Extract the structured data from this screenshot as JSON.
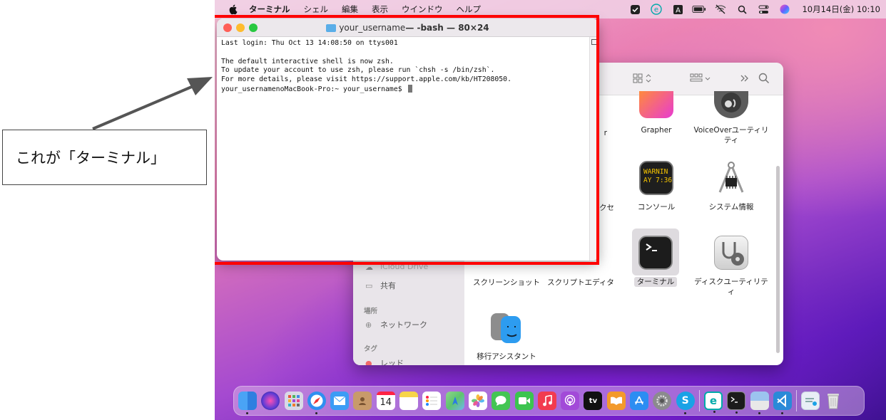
{
  "annotation": {
    "text": "これが「ターミナル」"
  },
  "menubar": {
    "app_name": "ターミナル",
    "items": [
      "シェル",
      "編集",
      "表示",
      "ウインドウ",
      "ヘルプ"
    ],
    "clock": "10月14日(金)  10:10",
    "status_icons": [
      "shield-check-icon",
      "eset-icon",
      "input-method-icon",
      "battery-icon",
      "wifi-off-icon",
      "search-icon",
      "control-center-icon",
      "siri-icon"
    ]
  },
  "terminal": {
    "title": "your_username — -bash — 80×24",
    "title_user": "your_username",
    "title_rest": " — -bash — 80×24",
    "lines": [
      "Last login: Thu Oct 13 14:08:50 on ttys001",
      "",
      "The default interactive shell is now zsh.",
      "To update your account to use zsh, please run `chsh -s /bin/zsh`.",
      "For more details, please visit https://support.apple.com/kb/HT208050."
    ],
    "prompt": "your_usernamenoMacBook-Pro:~ your_username$ "
  },
  "finder": {
    "sidebar": {
      "icloud": "iCloud Drive",
      "shared": "共有",
      "locations_header": "場所",
      "network": "ネットワーク",
      "tags_header": "タグ",
      "tag_red": "レッド"
    },
    "apps": [
      {
        "name": "Grapher",
        "icon": "grapher-icon"
      },
      {
        "name": "VoiceOverユーティリティ",
        "icon": "voiceover-icon"
      },
      {
        "name": "コンソール",
        "icon": "console-icon",
        "text": "WARNIN\nAY 7:36"
      },
      {
        "name": "システム情報",
        "icon": "system-info-icon"
      },
      {
        "name": "ターミナル",
        "icon": "terminal-icon",
        "selected": true
      },
      {
        "name": "ディスクユーティリティ",
        "icon": "disk-utility-icon"
      },
      {
        "name": "スクリーンショット",
        "icon": "screenshot-icon"
      },
      {
        "name": "スクリプトエディタ",
        "icon": "script-editor-icon"
      },
      {
        "name": "移行アシスタント",
        "icon": "migration-assistant-icon"
      }
    ],
    "partial_labels": {
      "left_top": "r",
      "left_mid": "クセ"
    }
  },
  "dock": {
    "items": [
      {
        "name": "finder-icon",
        "color": "#3d8ef0",
        "running": true
      },
      {
        "name": "siri-icon",
        "color": "#2a2a6a"
      },
      {
        "name": "launchpad-icon",
        "color": "#d9d9e6"
      },
      {
        "name": "safari-icon",
        "color": "#2f8ff0",
        "running": true
      },
      {
        "name": "mail-icon",
        "color": "#3c9cf5"
      },
      {
        "name": "contacts-icon",
        "color": "#c89a6a"
      },
      {
        "name": "calendar-icon",
        "color": "#ffffff",
        "label": "14"
      },
      {
        "name": "notes-icon",
        "color": "#f7d54a"
      },
      {
        "name": "reminders-icon",
        "color": "#ffffff"
      },
      {
        "name": "maps-icon",
        "color": "#5ec46e"
      },
      {
        "name": "photos-icon",
        "color": "#ffffff"
      },
      {
        "name": "messages-icon",
        "color": "#43c553"
      },
      {
        "name": "facetime-icon",
        "color": "#3bc44f"
      },
      {
        "name": "music-icon",
        "color": "#f23b4f"
      },
      {
        "name": "podcasts-icon",
        "color": "#a24ad8"
      },
      {
        "name": "tv-icon",
        "color": "#111111",
        "label": "tv"
      },
      {
        "name": "books-icon",
        "color": "#f39a2b"
      },
      {
        "name": "app-store-icon",
        "color": "#2c8df2"
      },
      {
        "name": "system-preferences-icon",
        "color": "#8b8b8e"
      },
      {
        "name": "skype-icon",
        "color": "#1aa2e6",
        "label": "S",
        "running": true
      },
      {
        "name": "eset-icon",
        "color": "#ffffff",
        "label": "e",
        "running": true
      },
      {
        "name": "terminal-icon",
        "color": "#1b1b1b",
        "running": true
      },
      {
        "name": "preview-icon",
        "color": "#cfd8e6",
        "running": true
      },
      {
        "name": "vscode-icon",
        "color": "#2a8ad8",
        "running": true
      },
      {
        "name": "downloads-folder-icon",
        "color": "#e8eef6"
      },
      {
        "name": "trash-icon",
        "color": "#dcdcdc"
      }
    ]
  }
}
